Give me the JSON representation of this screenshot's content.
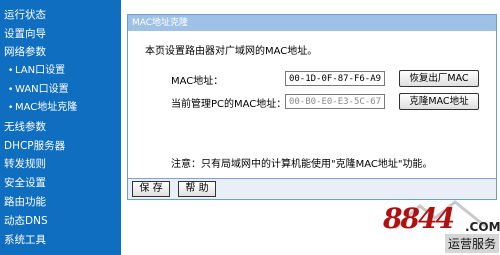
{
  "sidebar": {
    "items": [
      {
        "label": "运行状态"
      },
      {
        "label": "设置向导"
      },
      {
        "label": "网络参数"
      },
      {
        "label": "LAN口设置",
        "bullet": "•"
      },
      {
        "label": "WAN口设置",
        "bullet": "•"
      },
      {
        "label": "MAC地址克隆",
        "bullet": "•"
      },
      {
        "label": "无线参数"
      },
      {
        "label": "DHCP服务器"
      },
      {
        "label": "转发规则"
      },
      {
        "label": "安全设置"
      },
      {
        "label": "路由功能"
      },
      {
        "label": "动态DNS"
      },
      {
        "label": "系统工具"
      }
    ]
  },
  "panel": {
    "title": "MAC地址克隆",
    "description": "本页设置路由器对广域网的MAC地址。",
    "mac_label": "MAC地址：",
    "mac_value": "00-1D-0F-87-F6-A9",
    "restore_button": "恢复出厂MAC",
    "pc_mac_label": "当前管理PC的MAC地址：",
    "pc_mac_value": "00-B0-E0-E3-5C-67",
    "clone_button": "克隆MAC地址",
    "note": "注意：只有局域网中的计算机能使用\"克隆MAC地址\"功能。"
  },
  "bottom": {
    "save": "保 存",
    "help": "帮 助"
  },
  "watermark": {
    "logo": "8844",
    "dotcom": ".COM",
    "sub": "运营服务"
  },
  "colors": {
    "sidebar_bg": "#0f6ec0",
    "panel_title_bg": "#9fc1e6",
    "logo_red": "#b01010"
  }
}
